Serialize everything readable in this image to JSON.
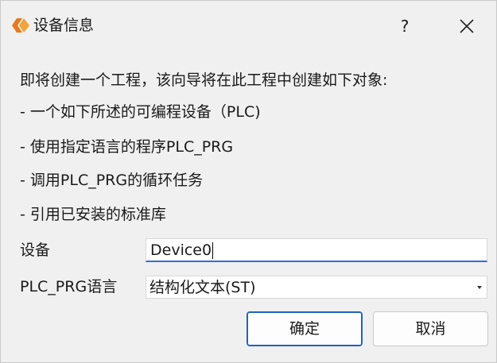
{
  "window": {
    "title": "设备信息",
    "help_label": "?",
    "icons": {
      "app": "app-logo-icon",
      "close": "close-icon"
    },
    "accent_color": "#2f6fd6",
    "logo_colors": [
      "#e8791d",
      "#f2a33a"
    ]
  },
  "description": {
    "lines": [
      "即将创建一个工程，该向导将在此工程中创建如下对象:",
      "- 一个如下所述的可编程设备（PLC)",
      "- 使用指定语言的程序PLC_PRG",
      "- 调用PLC_PRG的循环任务",
      "- 引用已安装的标准库"
    ]
  },
  "form": {
    "device_label": "设备",
    "device_value": "Device0",
    "language_label": "PLC_PRG语言",
    "language_value": "结构化文本(ST)"
  },
  "buttons": {
    "ok_label": "确定",
    "cancel_label": "取消"
  }
}
